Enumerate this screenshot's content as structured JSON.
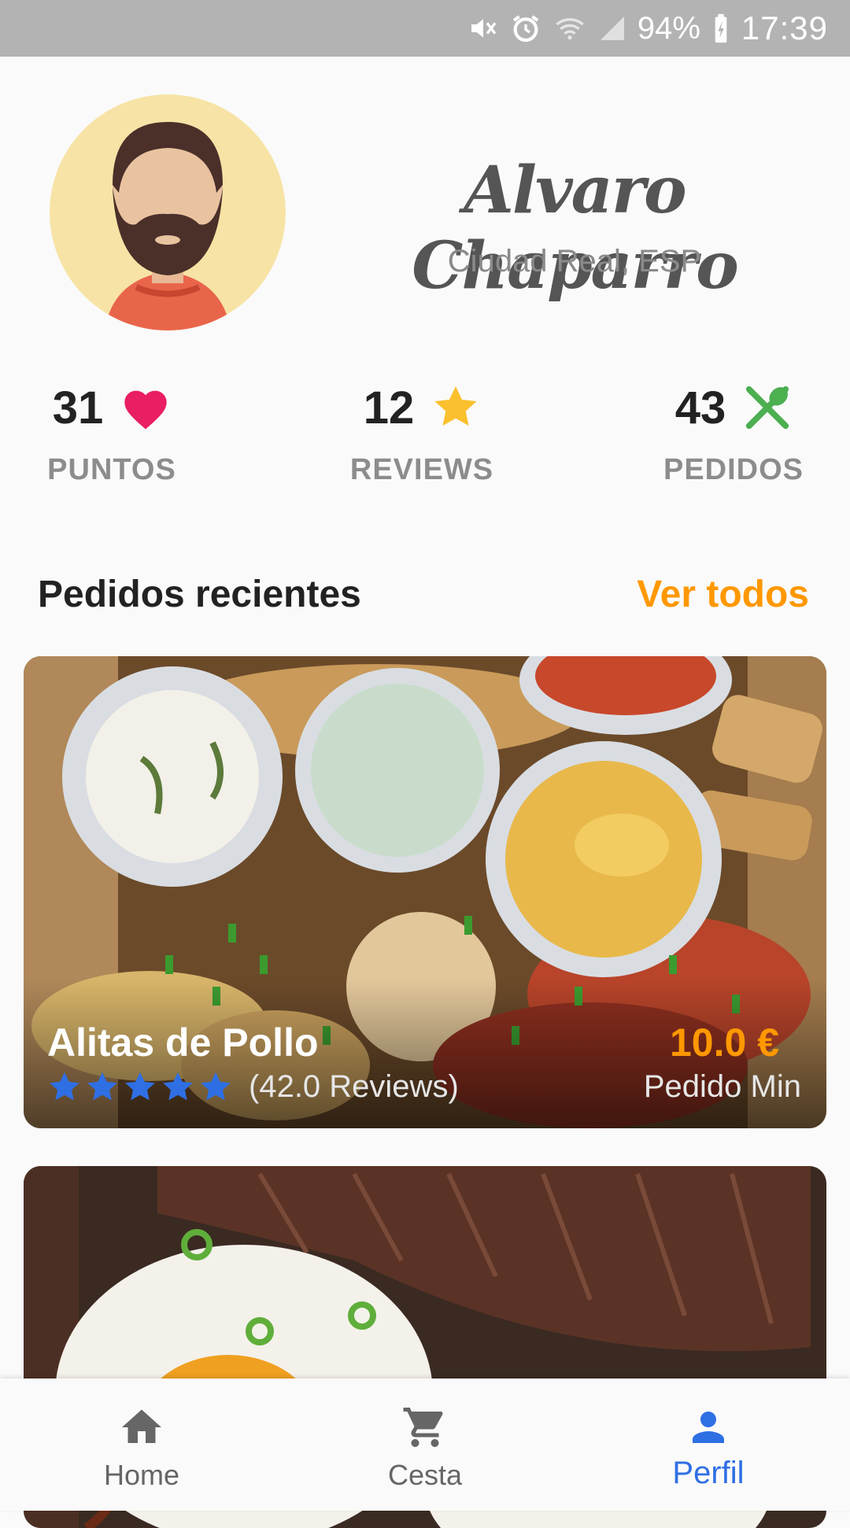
{
  "status_bar": {
    "battery_percent": "94%",
    "time": "17:39",
    "icons": [
      "mute-icon",
      "alarm-icon",
      "wifi-icon",
      "signal-icon",
      "battery-charging-icon"
    ]
  },
  "profile": {
    "name": "Alvaro Chaparro",
    "location": "Ciudad Real, ESP",
    "avatar": "bearded-man-avatar"
  },
  "stats": [
    {
      "value": "31",
      "label": "PUNTOS",
      "icon": "heart-icon",
      "color": "#e91e63"
    },
    {
      "value": "12",
      "label": "REVIEWS",
      "icon": "star-icon",
      "color": "#fbc02d"
    },
    {
      "value": "43",
      "label": "PEDIDOS",
      "icon": "utensils-icon",
      "color": "#4caf50"
    }
  ],
  "recent": {
    "title": "Pedidos recientes",
    "view_all": "Ver todos"
  },
  "orders": [
    {
      "name": "Alitas de Pollo",
      "rating": 5,
      "reviews": "(42.0 Reviews)",
      "price": "10.0 €",
      "price_label": "Pedido Min"
    }
  ],
  "nav": {
    "items": [
      {
        "label": "Home",
        "icon": "home-icon"
      },
      {
        "label": "Cesta",
        "icon": "cart-icon"
      },
      {
        "label": "Perfil",
        "icon": "person-icon",
        "active": true
      }
    ],
    "active_color": "#2f6fe4",
    "accent_color": "#ff9800"
  }
}
